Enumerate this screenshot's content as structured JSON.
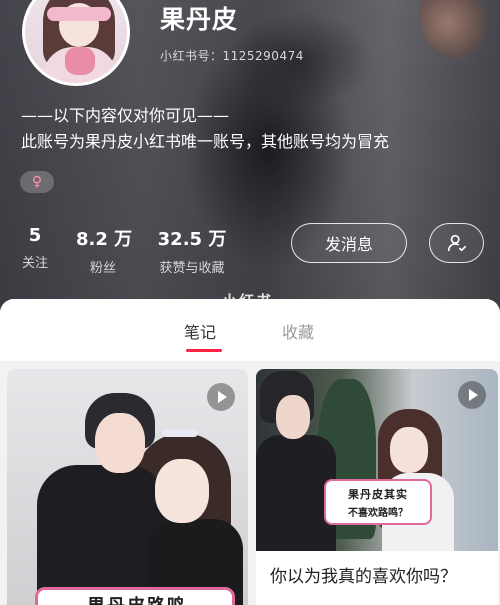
{
  "profile": {
    "nickname": "果丹皮",
    "redbook_id": "小红书号：1125290474",
    "bio_line_1": "——以下内容仅对你可见——",
    "bio_line_2": "此账号为果丹皮小红书唯一账号，其他账号均为冒充",
    "gender_icon": "female-icon",
    "gender_symbol": "♀"
  },
  "stats": {
    "following": {
      "value": "5",
      "label": "关注"
    },
    "fans": {
      "value": "8.2 万",
      "label": "粉丝"
    },
    "likes": {
      "value": "32.5 万",
      "label": "获赞与收藏"
    }
  },
  "actions": {
    "message_label": "发消息",
    "follow_icon": "user-check-icon"
  },
  "watermark": "小红书",
  "tabs": [
    {
      "label": "笔记",
      "active": true
    },
    {
      "label": "收藏",
      "active": false
    }
  ],
  "notes": [
    {
      "type": "video",
      "cover_caption": "果丹皮路鸣"
    },
    {
      "type": "video",
      "cover_caption_1": "果丹皮其实",
      "cover_caption_2": "不喜欢路鸣？",
      "title": "你以为我真的喜欢你吗？"
    }
  ],
  "colors": {
    "accent": "#ff2442",
    "header_bg": "#4f4e55",
    "banner_border": "#e06a9c"
  }
}
